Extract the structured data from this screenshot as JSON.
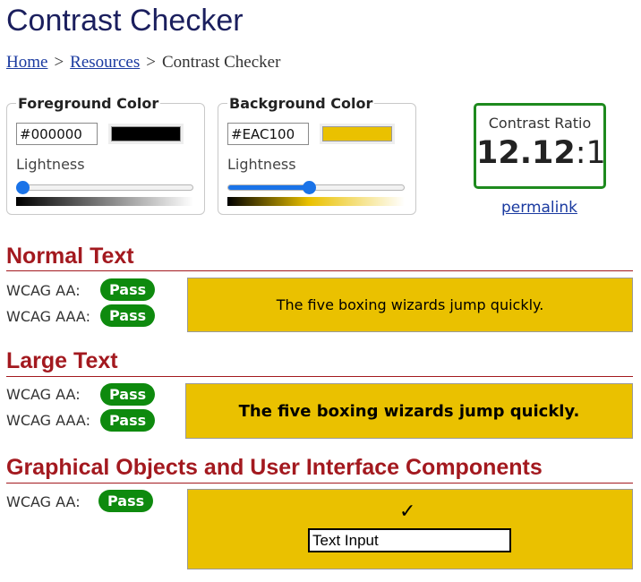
{
  "title": "Contrast Checker",
  "breadcrumb": {
    "home": "Home",
    "resources": "Resources",
    "separator": ">",
    "current": "Contrast Checker"
  },
  "foreground": {
    "title": "Foreground Color",
    "value": "#000000",
    "lightness_label": "Lightness",
    "lightness_percent": 0
  },
  "background": {
    "title": "Background Color",
    "value": "#EAC100",
    "lightness_label": "Lightness",
    "lightness_percent": 46
  },
  "ratio": {
    "label": "Contrast Ratio",
    "value": "12.12",
    "suffix": ":1",
    "permalink": "permalink"
  },
  "sections": {
    "normal": {
      "title": "Normal Text",
      "aa_label": "WCAG AA:",
      "aa_result": "Pass",
      "aaa_label": "WCAG AAA:",
      "aaa_result": "Pass",
      "sample": "The five boxing wizards jump quickly."
    },
    "large": {
      "title": "Large Text",
      "aa_label": "WCAG AA:",
      "aa_result": "Pass",
      "aaa_label": "WCAG AAA:",
      "aaa_result": "Pass",
      "sample": "The five boxing wizards jump quickly."
    },
    "graphical": {
      "title": "Graphical Objects and User Interface Components",
      "aa_label": "WCAG AA:",
      "aa_result": "Pass",
      "check_glyph": "✓",
      "input_value": "Text Input"
    }
  },
  "colors": {
    "accent_red": "#a3191f",
    "pass_green": "#0e8a0e",
    "link_blue": "#1a3aa0",
    "slider_blue": "#1a73e8",
    "foreground": "#000000",
    "background": "#EAC100"
  }
}
